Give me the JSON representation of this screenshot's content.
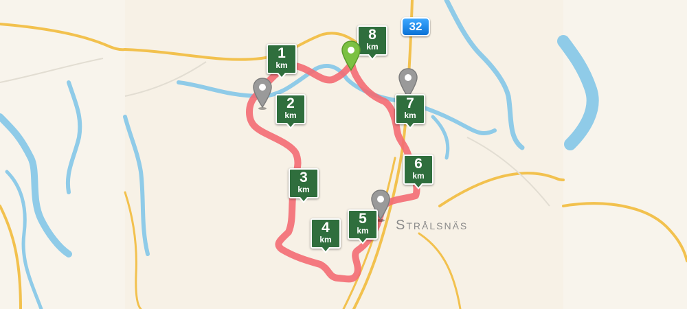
{
  "map": {
    "road_sign": "32",
    "place_name": "Strålsnäs",
    "distance_unit": "km",
    "km_markers": [
      "1",
      "2",
      "3",
      "4",
      "5",
      "6",
      "7",
      "8"
    ],
    "colors": {
      "land": "#f7f1e6",
      "water": "#8fcbe8",
      "road": "#f2c14e",
      "route": "#f36b73",
      "marker": "#2f6e3d",
      "start_pin": "#7bc142",
      "waypoint_pin": "#9a9a9a",
      "road_sign": "#1a86e8"
    }
  }
}
